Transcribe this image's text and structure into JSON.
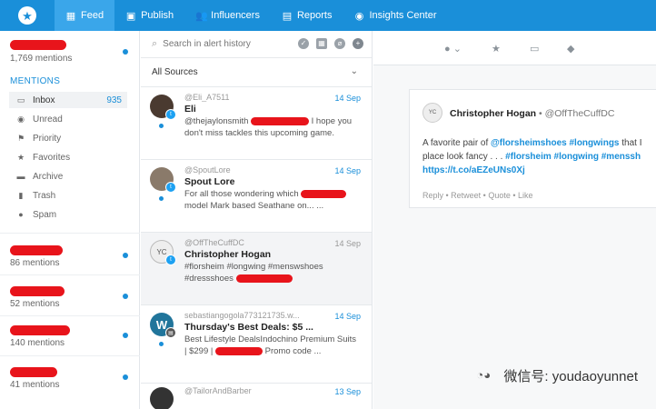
{
  "nav": {
    "logo_icon": "star-icon",
    "tabs": [
      {
        "label": "Feed",
        "icon": "home-icon",
        "active": true
      },
      {
        "label": "Publish",
        "icon": "publish-icon",
        "active": false
      },
      {
        "label": "Influencers",
        "icon": "users-icon",
        "active": false
      },
      {
        "label": "Reports",
        "icon": "reports-icon",
        "active": false
      },
      {
        "label": "Insights Center",
        "icon": "insights-icon",
        "active": false
      }
    ]
  },
  "sidebar": {
    "main_account": {
      "mentions": "1,769 mentions"
    },
    "section_title": "MENTIONS",
    "items": [
      {
        "label": "Inbox",
        "icon": "inbox-icon",
        "count": "935"
      },
      {
        "label": "Unread",
        "icon": "eye-icon"
      },
      {
        "label": "Priority",
        "icon": "flag-icon"
      },
      {
        "label": "Favorites",
        "icon": "star-icon"
      },
      {
        "label": "Archive",
        "icon": "archive-icon"
      },
      {
        "label": "Trash",
        "icon": "trash-icon"
      },
      {
        "label": "Spam",
        "icon": "spam-icon"
      }
    ],
    "accounts": [
      {
        "mentions": "86 mentions"
      },
      {
        "mentions": "52 mentions"
      },
      {
        "mentions": "140 mentions"
      },
      {
        "mentions": "41 mentions"
      }
    ]
  },
  "alerts": {
    "search_placeholder": "Search in alert history",
    "source_filter": "All Sources",
    "items": [
      {
        "handle": "@Eli_A7511",
        "date": "14 Sep",
        "name": "Eli",
        "body_lines": [
          "@thejaylonsmith",
          "I hope you",
          "don't miss tackles this upcoming game."
        ]
      },
      {
        "handle": "@SpoutLore",
        "date": "14 Sep",
        "name": "Spout Lore",
        "body_lines": [
          "For all those wondering which",
          "model Mark based Seathane on... ..."
        ]
      },
      {
        "handle": "@OffTheCuffDC",
        "date": "14 Sep",
        "name": "Christopher Hogan",
        "body_lines": [
          "#florsheim #longwing #menswshoes",
          "#dressshoes"
        ]
      },
      {
        "handle": "sebastiangogola773121735.w...",
        "date": "14 Sep",
        "name": "Thursday's Best Deals: $5 ...",
        "body_lines": [
          "Best Lifestyle DealsIndochino Premium Suits",
          "| $299 |",
          "Promo code ..."
        ]
      },
      {
        "handle": "@TailorAndBarber",
        "date": "13 Sep"
      }
    ]
  },
  "detail": {
    "name": "Christopher Hogan",
    "separator": " • ",
    "handle": "@OffTheCuffDC",
    "avatar_text": "YC",
    "text_line1_plain": "A favorite pair of ",
    "text_line1_tags": "@florsheimshoes #longwings",
    "text_line1_end": " that I",
    "text_line2_plain": "place look fancy . . . ",
    "text_line2_tags": "#florsheim #longwing #menssh",
    "link": "https://t.co/aEZeUNs0Xj",
    "actions": "Reply • Retweet • Quote • Like"
  },
  "watermark": {
    "text": "微信号: youdaoyunnet"
  },
  "colors": {
    "brand": "#1a8fd9",
    "active_tab": "#3aa6ea",
    "twitter": "#1da1f2",
    "redaction": "#e8141b"
  }
}
